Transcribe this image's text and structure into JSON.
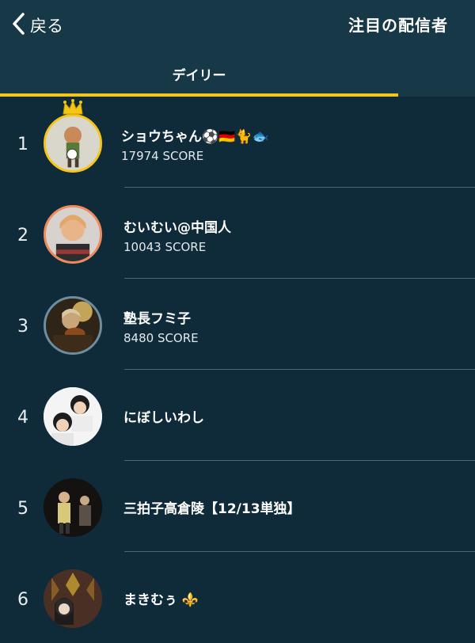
{
  "header": {
    "back_label": "戻る",
    "title": "注目の配信者"
  },
  "tabs": [
    {
      "label": "デイリー",
      "selected": true
    }
  ],
  "accent_color": "#f5c518",
  "rankings": [
    {
      "rank": "1",
      "name": "ショウちゃん⚽️🇩🇪🐈🐟",
      "score": "17974 SCORE",
      "border": "#f5c518",
      "crown": true
    },
    {
      "rank": "2",
      "name": "むいむい@中国人",
      "score": "10043 SCORE",
      "border": "#f08a5d"
    },
    {
      "rank": "3",
      "name": "塾長フミ子",
      "score": "8480 SCORE",
      "border": "#6d8ea0"
    },
    {
      "rank": "4",
      "name": "にぼしいわし",
      "score": ""
    },
    {
      "rank": "5",
      "name": "三拍子高倉陵【12/13単独】",
      "score": ""
    },
    {
      "rank": "6",
      "name": "まきむぅ ⚜️",
      "score": ""
    }
  ]
}
